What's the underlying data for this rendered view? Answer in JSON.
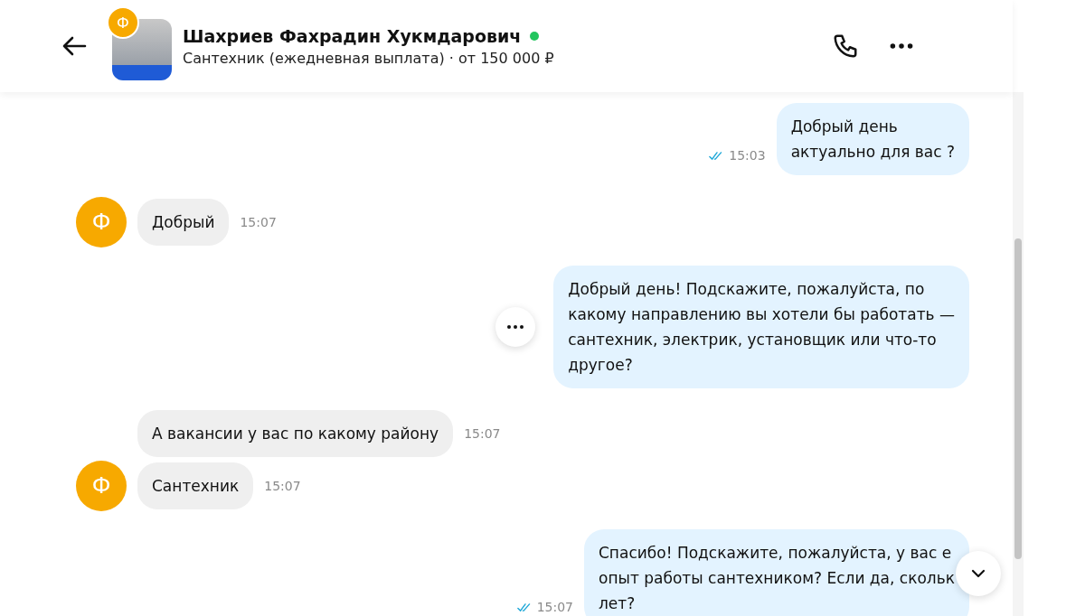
{
  "header": {
    "avatar_letter": "Ф",
    "name": "Шахриев Фахрадин Хукмдарович",
    "online": true,
    "subtitle": "Сантехник (ежедневная выплата) · от 150 000 ₽"
  },
  "messages": [
    {
      "kind": "out",
      "text": "Добрый день\nактуально для вас ?",
      "time": "15:03",
      "read": true,
      "menu": false
    },
    {
      "kind": "in",
      "text": "Добрый",
      "time": "15:07",
      "avatar": true,
      "avatar_letter": "Ф"
    },
    {
      "kind": "out",
      "text": "Добрый день! Подскажите, пожалуйста, по\nкакому направлению вы хотели бы работать —\nсантехник, электрик, установщик или что-то\nдругое?",
      "menu": true
    },
    {
      "kind": "in",
      "text": "А вакансии у вас по какому району",
      "time": "15:07",
      "avatar": false
    },
    {
      "kind": "in",
      "text": "Сантехник",
      "time": "15:07",
      "avatar": true,
      "avatar_letter": "Ф"
    },
    {
      "kind": "out",
      "text": "Спасибо! Подскажите, пожалуйста, у вас е\nопыт работы сантехником? Если да, скольк\nлет?",
      "time": "15:07",
      "read": true,
      "menu": false
    }
  ]
}
